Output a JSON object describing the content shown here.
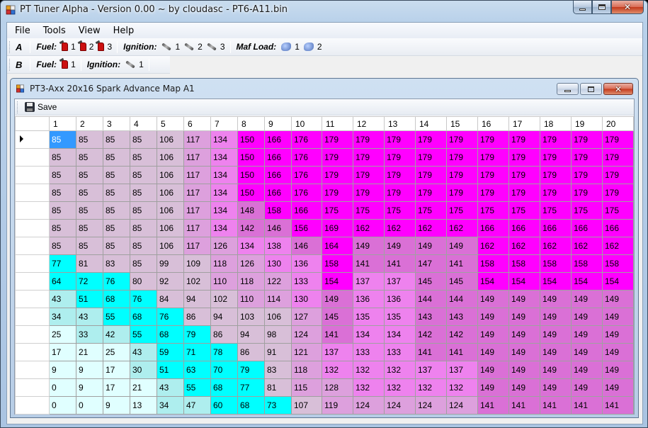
{
  "window": {
    "title": "PT Tuner Alpha - Version 0.00 ~ by cloudasc - PT6-A11.bin"
  },
  "menu": [
    "File",
    "Tools",
    "View",
    "Help"
  ],
  "toolbar_a": {
    "row_label": "A",
    "fuel_label": "Fuel:",
    "fuel_items": [
      "1",
      "2",
      "3"
    ],
    "ignition_label": "Ignition:",
    "ignition_items": [
      "1",
      "2",
      "3"
    ],
    "maf_label": "Maf Load:",
    "maf_items": [
      "1",
      "2"
    ]
  },
  "toolbar_b": {
    "row_label": "B",
    "fuel_label": "Fuel:",
    "fuel_items": [
      "1"
    ],
    "ignition_label": "Ignition:",
    "ignition_items": [
      "1"
    ]
  },
  "child": {
    "title": "PT3-Axx 20x16 Spark Advance Map A1",
    "save_label": "Save"
  },
  "colors": {
    "cyan": "#00ffff",
    "light_cyan": "#e0ffff",
    "pale_cyan": "#aeeeee",
    "light_lavender": "#d8bfd8",
    "orchid": "#dda0dd",
    "violet": "#ee82ee",
    "orchid_mid": "#da70d6",
    "magenta": "#ff00ff",
    "selection": "#3399ff"
  },
  "grid": {
    "columns": [
      "1",
      "2",
      "3",
      "4",
      "5",
      "6",
      "7",
      "8",
      "9",
      "10",
      "11",
      "12",
      "13",
      "14",
      "15",
      "16",
      "17",
      "18",
      "19",
      "20"
    ],
    "selected_row": 0,
    "selected_col": 0,
    "rows": [
      [
        85,
        85,
        85,
        85,
        106,
        117,
        134,
        150,
        166,
        176,
        179,
        179,
        179,
        179,
        179,
        179,
        179,
        179,
        179,
        179
      ],
      [
        85,
        85,
        85,
        85,
        106,
        117,
        134,
        150,
        166,
        176,
        179,
        179,
        179,
        179,
        179,
        179,
        179,
        179,
        179,
        179
      ],
      [
        85,
        85,
        85,
        85,
        106,
        117,
        134,
        150,
        166,
        176,
        179,
        179,
        179,
        179,
        179,
        179,
        179,
        179,
        179,
        179
      ],
      [
        85,
        85,
        85,
        85,
        106,
        117,
        134,
        150,
        166,
        176,
        179,
        179,
        179,
        179,
        179,
        179,
        179,
        179,
        179,
        179
      ],
      [
        85,
        85,
        85,
        85,
        106,
        117,
        134,
        148,
        158,
        166,
        175,
        175,
        175,
        175,
        175,
        175,
        175,
        175,
        175,
        175
      ],
      [
        85,
        85,
        85,
        85,
        106,
        117,
        134,
        142,
        146,
        156,
        169,
        162,
        162,
        162,
        162,
        166,
        166,
        166,
        166,
        166
      ],
      [
        85,
        85,
        85,
        85,
        106,
        117,
        126,
        134,
        138,
        146,
        164,
        149,
        149,
        149,
        149,
        162,
        162,
        162,
        162,
        162
      ],
      [
        77,
        81,
        83,
        85,
        99,
        109,
        118,
        126,
        130,
        136,
        158,
        141,
        141,
        147,
        141,
        158,
        158,
        158,
        158,
        158
      ],
      [
        64,
        72,
        76,
        80,
        92,
        102,
        110,
        118,
        122,
        133,
        154,
        137,
        137,
        145,
        145,
        154,
        154,
        154,
        154,
        154
      ],
      [
        43,
        51,
        68,
        76,
        84,
        94,
        102,
        110,
        114,
        130,
        149,
        136,
        136,
        144,
        144,
        149,
        149,
        149,
        149,
        149
      ],
      [
        34,
        43,
        55,
        68,
        76,
        86,
        94,
        103,
        106,
        127,
        145,
        135,
        135,
        143,
        143,
        149,
        149,
        149,
        149,
        149
      ],
      [
        25,
        33,
        42,
        55,
        68,
        79,
        86,
        94,
        98,
        124,
        141,
        134,
        134,
        142,
        142,
        149,
        149,
        149,
        149,
        149
      ],
      [
        17,
        21,
        25,
        43,
        59,
        71,
        78,
        86,
        91,
        121,
        137,
        133,
        133,
        141,
        141,
        149,
        149,
        149,
        149,
        149
      ],
      [
        9,
        9,
        17,
        30,
        51,
        63,
        70,
        79,
        83,
        118,
        132,
        132,
        132,
        137,
        137,
        149,
        149,
        149,
        149,
        149
      ],
      [
        0,
        9,
        17,
        21,
        43,
        55,
        68,
        77,
        81,
        115,
        128,
        132,
        132,
        132,
        132,
        149,
        149,
        149,
        149,
        149
      ],
      [
        0,
        0,
        9,
        13,
        34,
        47,
        60,
        68,
        73,
        107,
        119,
        124,
        124,
        124,
        124,
        141,
        141,
        141,
        141,
        141
      ]
    ]
  }
}
